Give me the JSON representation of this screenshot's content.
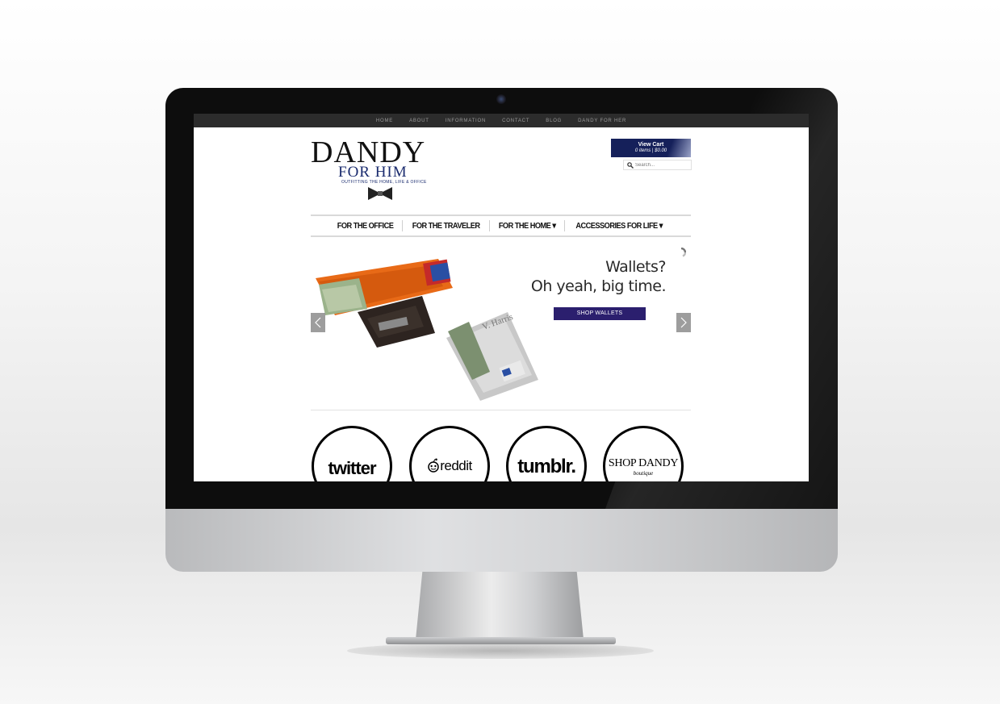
{
  "topnav": [
    "HOME",
    "ABOUT",
    "INFORMATION",
    "CONTACT",
    "BLOG",
    "DANDY FOR HER"
  ],
  "logo": {
    "main": "DANDY",
    "sub": "FOR HIM",
    "tagline": "OUTFITTING THE HOME, LIFE & OFFICE"
  },
  "cart": {
    "title": "View Cart",
    "summary": "0 items | $0.00"
  },
  "search": {
    "placeholder": "Search..."
  },
  "mainnav": [
    "FOR THE OFFICE",
    "FOR THE TRAVELER",
    "FOR THE HOME",
    "ACCESSORIES FOR LIFE"
  ],
  "slide": {
    "line1": "Wallets?",
    "line2": "Oh yeah, big time.",
    "button": "SHOP WALLETS"
  },
  "social": [
    {
      "name": "twitter",
      "label": "twitter"
    },
    {
      "name": "reddit",
      "label": "reddit"
    },
    {
      "name": "tumblr",
      "label": "tumblr."
    },
    {
      "name": "shop-dandy",
      "label": "SHOP DANDY",
      "sub": "boutique"
    }
  ],
  "colors": {
    "brand_navy": "#1a2b6e",
    "cart_bg": "#15205a",
    "button_purple": "#2b1f6e",
    "topnav_bg": "#2c2c2c"
  }
}
